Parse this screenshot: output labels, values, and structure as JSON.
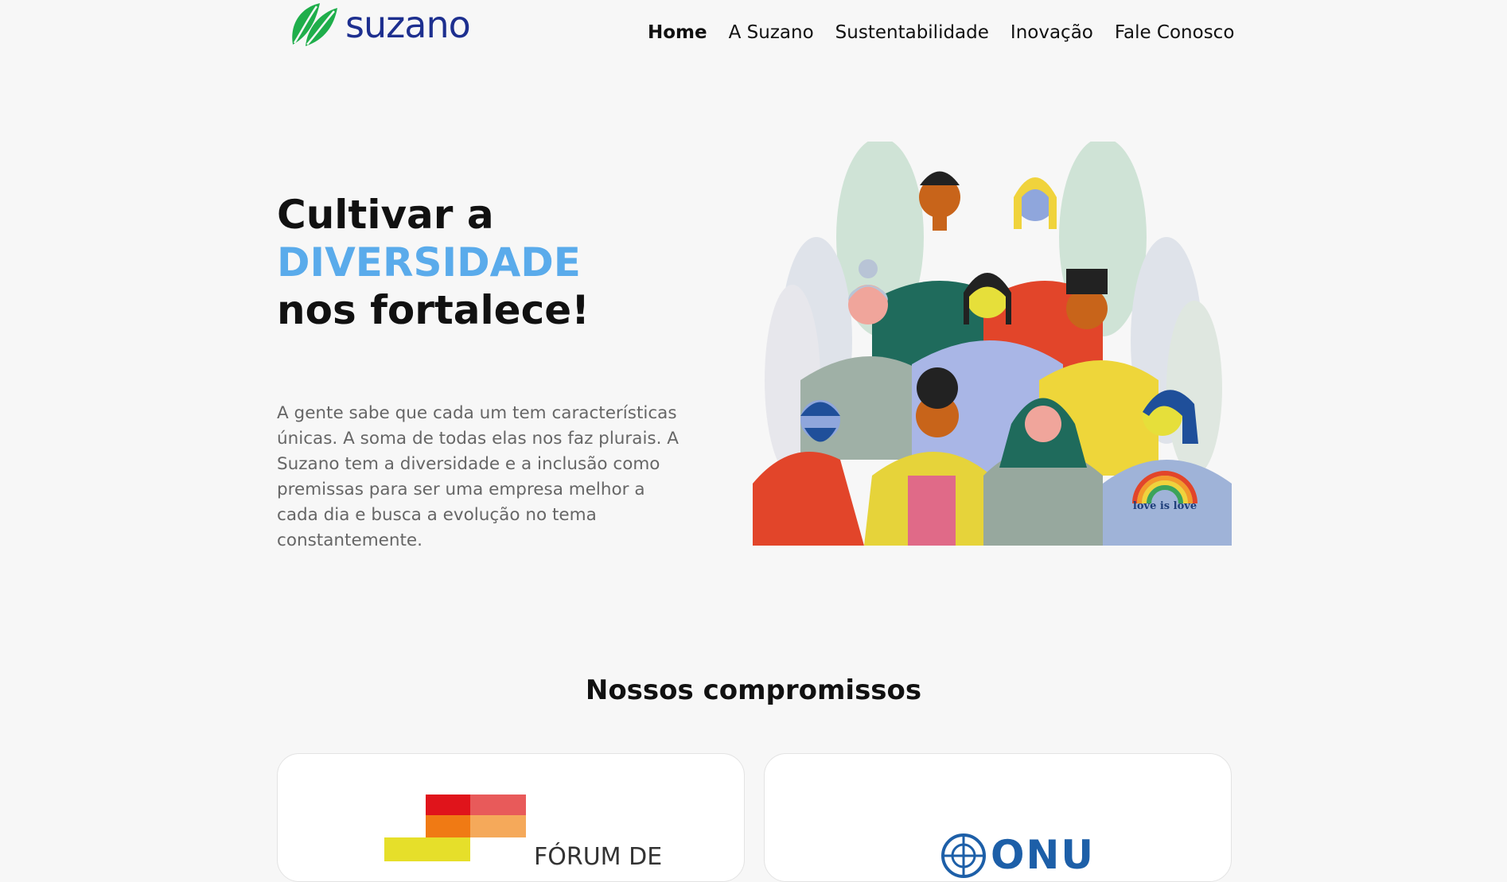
{
  "header": {
    "logo_text": "suzano",
    "logo_color": "#1d2f8f",
    "leaf_color": "#1fae4b",
    "nav": [
      {
        "label": "Home",
        "active": true
      },
      {
        "label": "A Suzano",
        "active": false
      },
      {
        "label": "Sustentabilidade",
        "active": false
      },
      {
        "label": "Inovação",
        "active": false
      },
      {
        "label": "Fale Conosco",
        "active": false
      }
    ]
  },
  "hero": {
    "title_line1": "Cultivar a",
    "title_accent": "DIVERSIDADE",
    "title_line3": "nos fortalece!",
    "accent_color": "#5aabeb",
    "description": "A gente sabe que cada um tem características únicas. A soma de todas elas nos faz plurais. A Suzano tem a diversidade e a inclusão como premissas para ser uma empresa melhor a cada dia e busca a evolução no tema constantemente.",
    "illustration_shirt_text": "love is love"
  },
  "commitments": {
    "title": "Nossos compromissos",
    "cards": [
      {
        "logo_text": "FÓRUM DE"
      },
      {
        "logo_text": "ONU"
      }
    ]
  }
}
